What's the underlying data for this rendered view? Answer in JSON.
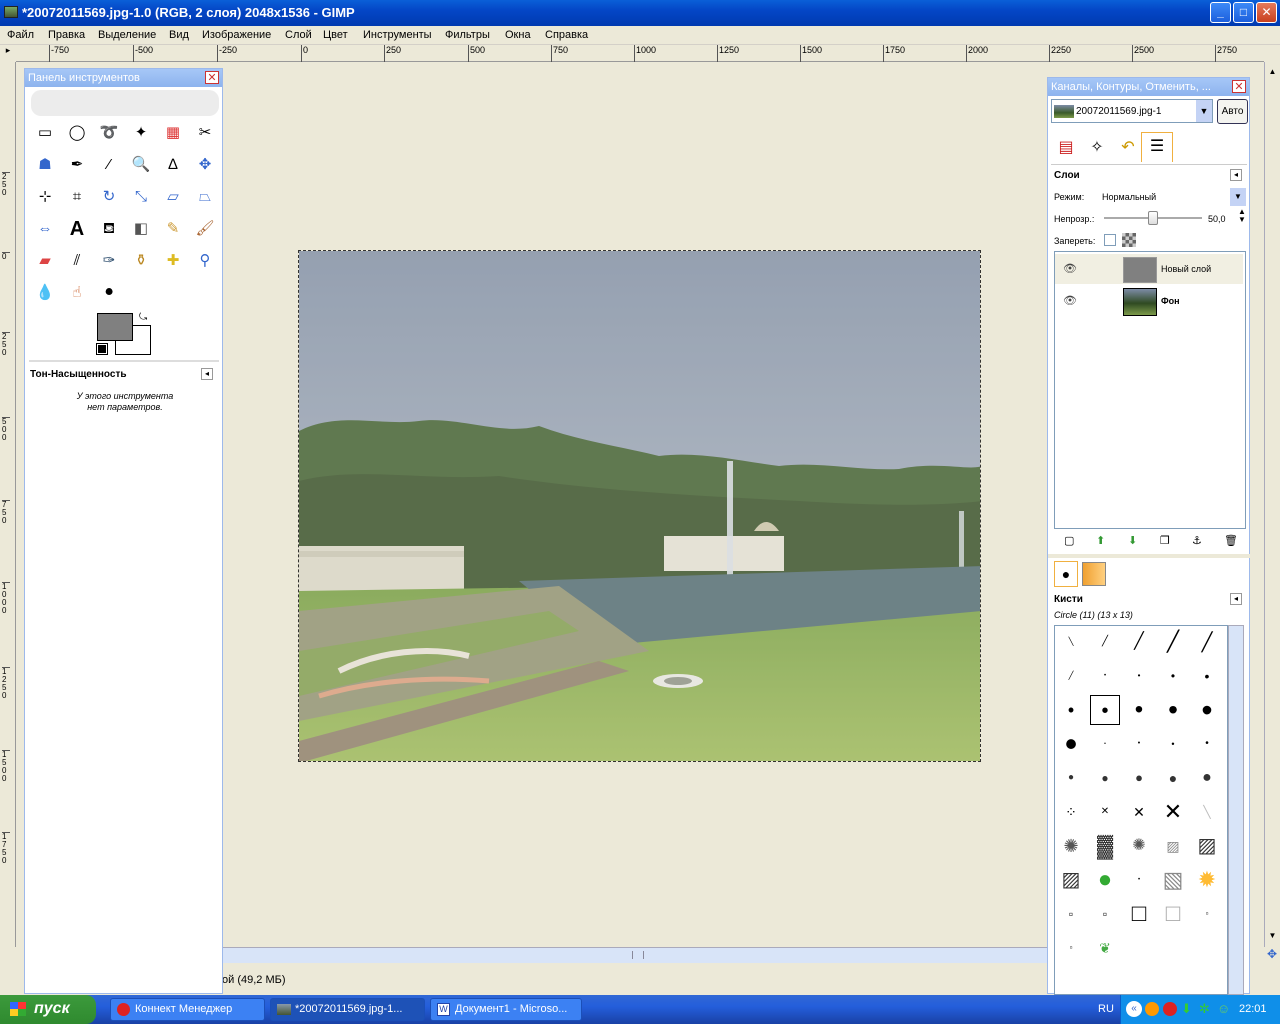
{
  "window": {
    "title": "*20072011569.jpg-1.0 (RGB, 2 слоя) 2048x1536 - GIMP",
    "minimize": "_",
    "maximize": "□",
    "close": "✕"
  },
  "menu": [
    "Файл",
    "Правка",
    "Выделение",
    "Вид",
    "Изображение",
    "Слой",
    "Цвет",
    "Инструменты",
    "Фильтры",
    "Окна",
    "Справка"
  ],
  "ruler_h": [
    "-750",
    "-500",
    "-250",
    "0",
    "250",
    "500",
    "750",
    "1000",
    "1250",
    "1500",
    "1750",
    "2000",
    "2250",
    "2500",
    "2750"
  ],
  "ruler_v": [
    "2\n5\n0",
    "0",
    "2\n5\n0",
    "5\n0\n0",
    "7\n5\n0",
    "1\n0\n0\n0",
    "1\n2\n5\n0",
    "1\n5\n0\n0",
    "1\n7\n5\n0"
  ],
  "toolbox": {
    "title": "Панель инструментов",
    "tool_options_title": "Тон-Насыщенность",
    "tool_options_text": [
      "У этого инструмента",
      "нет параметров."
    ],
    "colors": {
      "foreground": "#808080",
      "background": "#ffffff"
    }
  },
  "status": {
    "text": "ой (49,2 МБ)"
  },
  "dock": {
    "title": "Каналы, Контуры, Отменить, ...",
    "image_select": "20072011569.jpg-1",
    "auto_button": "Авто",
    "layers_title": "Слои",
    "mode_label": "Режим:",
    "mode_value": "Нормальный",
    "opacity_label": "Непрозр.:",
    "opacity_value": "50,0",
    "lock_label": "Запереть:",
    "layers": [
      {
        "name": "Новый слой",
        "visible": true,
        "bold": false
      },
      {
        "name": "Фон",
        "visible": true,
        "bold": true
      }
    ],
    "brushes_title": "Кисти",
    "brush_selected": "Circle (11) (13 x 13)"
  },
  "taskbar": {
    "start": "пуск",
    "tasks": [
      "Коннект Менеджер",
      "*20072011569.jpg-1...",
      "Документ1 - Microso..."
    ],
    "lang": "RU",
    "clock": "22:01"
  }
}
